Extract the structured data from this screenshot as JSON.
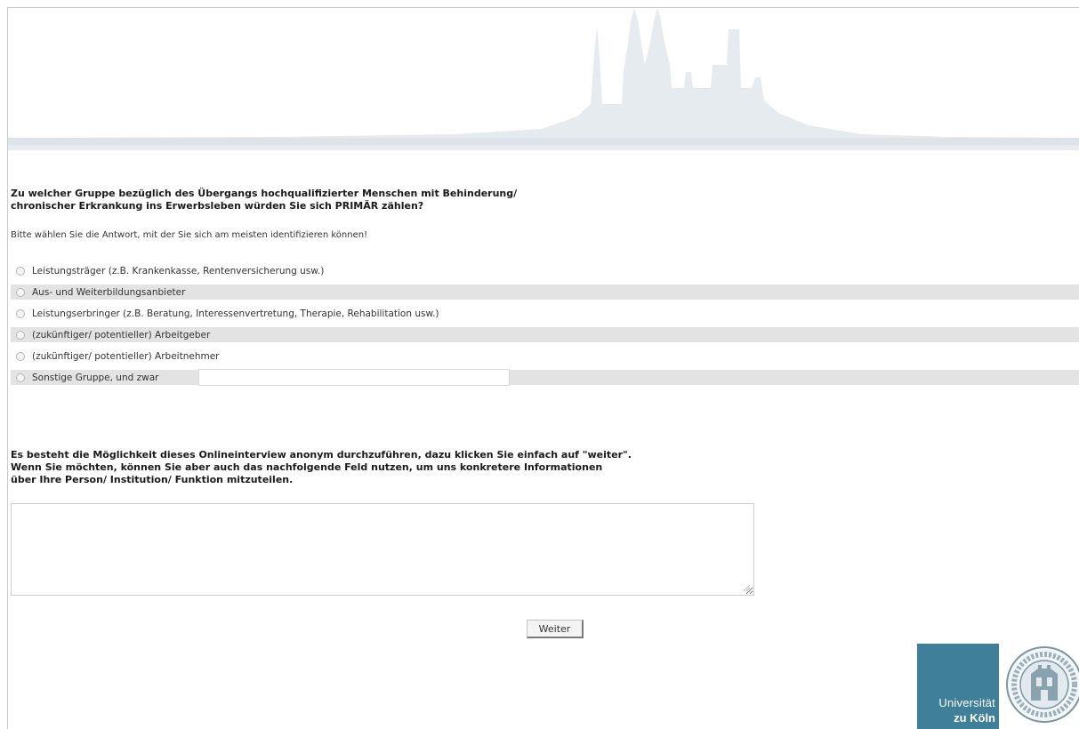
{
  "question": {
    "line1": "Zu welcher Gruppe bezüglich des Übergangs hochqualifizierter Menschen mit Behinderung/",
    "line2": "chronischer Erkrankung ins Erwerbsleben würden Sie sich PRIMÄR zählen?"
  },
  "instruction": "Bitte wählen Sie die Antwort, mit der Sie sich am meisten identifizieren können!",
  "options": [
    {
      "label": "Leistungsträger (z.B. Krankenkasse, Rentenversicherung usw.)",
      "selected": false
    },
    {
      "label": "Aus- und Weiterbildungsanbieter",
      "selected": false
    },
    {
      "label": "Leistungserbringer (z.B. Beratung, Interessenvertretung, Therapie, Rehabilitation usw.)",
      "selected": false
    },
    {
      "label": "(zukünftiger/ potentieller) Arbeitgeber",
      "selected": false
    },
    {
      "label": "(zukünftiger/ potentieller) Arbeitnehmer",
      "selected": false
    },
    {
      "label": "Sonstige Gruppe, und zwar",
      "selected": false
    }
  ],
  "other_input_value": "",
  "info": {
    "line1": "Es besteht die Möglichkeit dieses Onlineinterview anonym durchzuführen, dazu klicken Sie einfach auf \"weiter\".",
    "line2": "Wenn Sie möchten, können Sie aber auch das nachfolgende Feld nutzen, um uns konkretere Informationen",
    "line3": "über Ihre Person/ Institution/ Funktion mitzuteilen."
  },
  "comment_value": "",
  "next_label": "Weiter",
  "logo": {
    "line1": "Universität",
    "line2": "zu Köln"
  },
  "colors": {
    "logo_bg": "#3f7f9a",
    "skyline": "#e6ebef",
    "option_shade": "#e3e3e3"
  }
}
